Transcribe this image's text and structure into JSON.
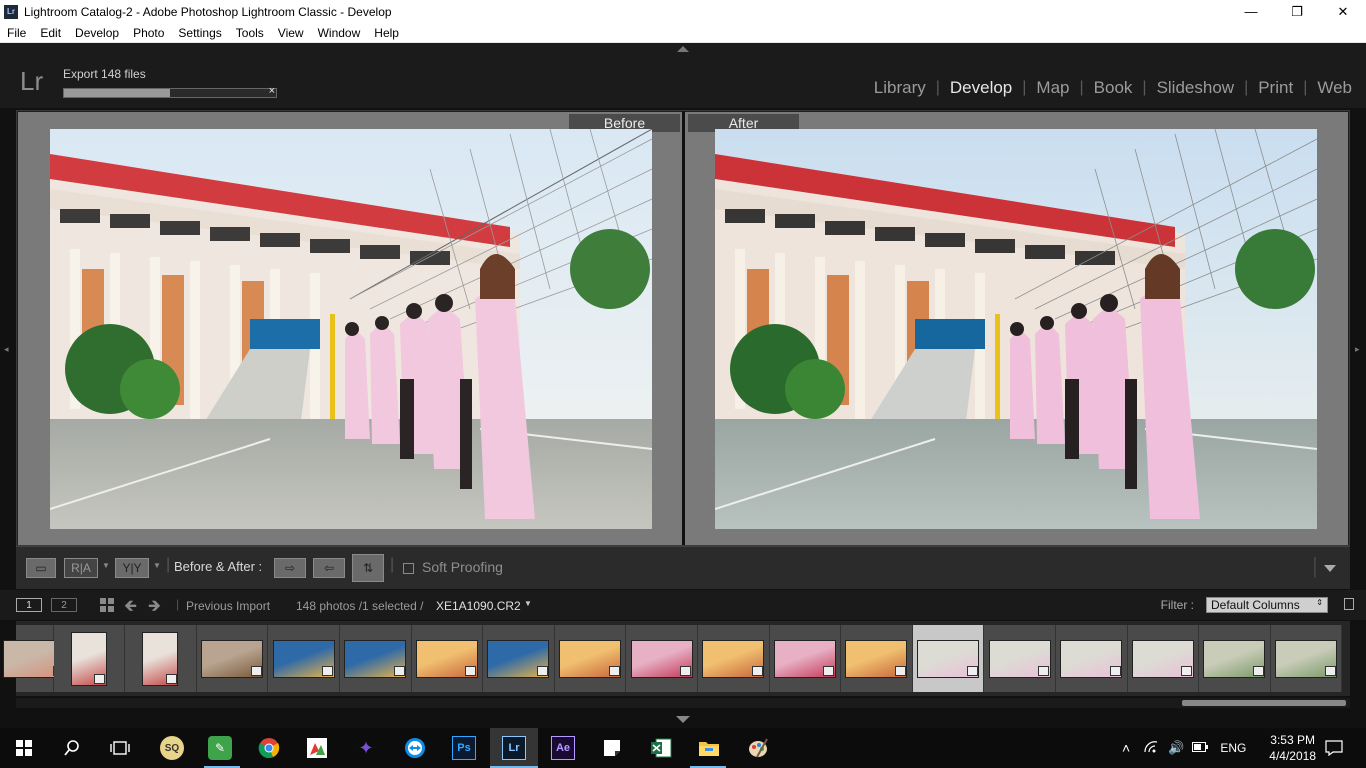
{
  "window": {
    "app_icon": "Lr",
    "title": "Lightroom Catalog-2 - Adobe Photoshop Lightroom Classic - Develop",
    "controls": [
      "minimize-icon",
      "restore-icon",
      "close-icon"
    ]
  },
  "menu": [
    "File",
    "Edit",
    "Develop",
    "Photo",
    "Settings",
    "Tools",
    "View",
    "Window",
    "Help"
  ],
  "identity": {
    "logo": "Lr",
    "export_label": "Export 148 files",
    "export_progress": 0.5,
    "cancel_glyph": "×",
    "modules": [
      {
        "label": "Library",
        "active": false
      },
      {
        "label": "Develop",
        "active": true
      },
      {
        "label": "Map",
        "active": false
      },
      {
        "label": "Book",
        "active": false
      },
      {
        "label": "Slideshow",
        "active": false
      },
      {
        "label": "Print",
        "active": false
      },
      {
        "label": "Web",
        "active": false
      }
    ],
    "separator": "|"
  },
  "view": {
    "before_label": "Before",
    "after_label": "After"
  },
  "toolbar": {
    "view_buttons": [
      "▭",
      "R|A",
      "Y|Y"
    ],
    "before_after_label": "Before & After :",
    "action_icons": [
      "copy-before-to-after-icon",
      "copy-after-to-before-icon",
      "swap-icon"
    ],
    "soft_proofing_label": "Soft Proofing",
    "soft_proofing_checked": false
  },
  "filmstrip_header": {
    "monitor_1": "1",
    "monitor_2": "2",
    "source": "Previous Import",
    "count": "148 photos /1 selected /",
    "filename": "XE1A1090.CR2",
    "filter_label": "Filter :",
    "filter_value": "Default Columns"
  },
  "filmstrip": {
    "thumbnails": [
      {
        "tone": "warm",
        "selected": false
      },
      {
        "tone": "building",
        "selected": false
      },
      {
        "tone": "building",
        "selected": false
      },
      {
        "tone": "building-dark",
        "selected": false
      },
      {
        "tone": "blue",
        "selected": false
      },
      {
        "tone": "blue",
        "selected": false
      },
      {
        "tone": "orange",
        "selected": false
      },
      {
        "tone": "blue",
        "selected": false
      },
      {
        "tone": "orange",
        "selected": false
      },
      {
        "tone": "pink",
        "selected": false
      },
      {
        "tone": "orange",
        "selected": false
      },
      {
        "tone": "pink",
        "selected": false
      },
      {
        "tone": "orange",
        "selected": false
      },
      {
        "tone": "group",
        "selected": true
      },
      {
        "tone": "group",
        "selected": false
      },
      {
        "tone": "group",
        "selected": false
      },
      {
        "tone": "group",
        "selected": false
      },
      {
        "tone": "green",
        "selected": false
      },
      {
        "tone": "green",
        "selected": false
      }
    ]
  },
  "taskbar": {
    "apps": [
      "start-icon",
      "search-icon",
      "task-view-icon",
      "sq-icon",
      "green-app-icon",
      "chrome-icon",
      "photo-app-icon",
      "purple-app-icon",
      "teamviewer-icon",
      "photoshop-icon",
      "lightroom-icon",
      "after-effects-icon",
      "sticky-notes-icon",
      "excel-icon",
      "file-explorer-icon",
      "paint-icon"
    ],
    "ps": "Ps",
    "lr": "Lr",
    "ae": "Ae",
    "lang": "ENG",
    "time": "3:53 PM",
    "date": "4/4/2018"
  },
  "colors": {
    "accent": "#76b9ed",
    "panel": "#2b2b2b",
    "view_bg": "#7a7a7a"
  }
}
